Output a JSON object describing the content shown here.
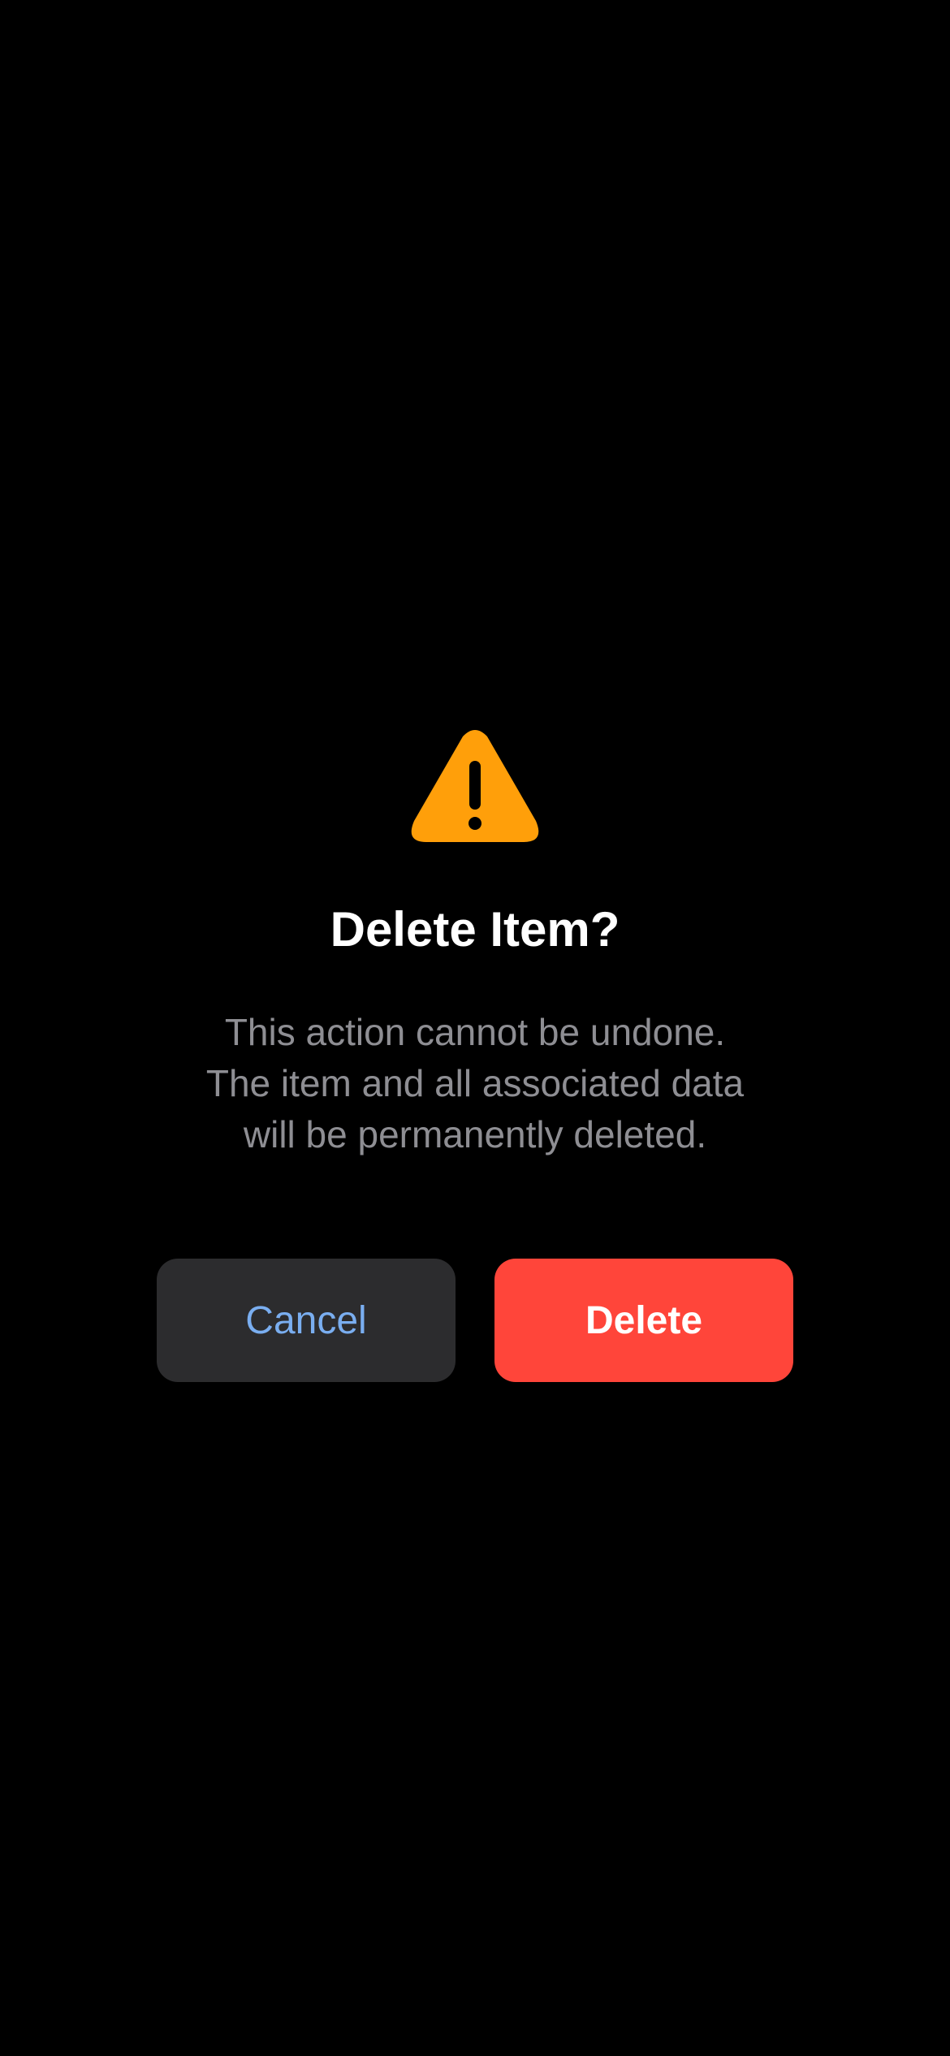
{
  "colors": {
    "background": "#000000",
    "warning": "#ff9f0a",
    "destructive": "#ff453a",
    "secondary_button": "#2c2c2e",
    "cancel_text": "#7aaef0",
    "message_text": "#8e8e93"
  },
  "dialog": {
    "icon": "warning-triangle-icon",
    "title": "Delete Item?",
    "message": "This action cannot be undone. The item and all associated data will be permanently deleted.",
    "cancel_label": "Cancel",
    "delete_label": "Delete"
  }
}
